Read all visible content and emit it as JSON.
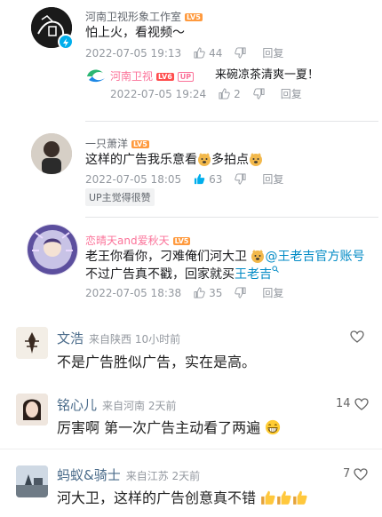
{
  "comments": [
    {
      "name": "河南卫视形象工作室",
      "level": "LV5",
      "text": "怕上火，看视频～",
      "time": "2022-07-05 19:13",
      "likes": "44",
      "reply_label": "回复",
      "subreply": {
        "name": "河南卫视",
        "level": "LV6",
        "badge": "UP",
        "text": "来碗凉茶清爽一夏！",
        "time": "2022-07-05 19:24",
        "likes": "2",
        "reply_label": "回复"
      }
    },
    {
      "name": "一只萧洋",
      "level": "LV5",
      "text_a": "这样的广告我乐意看",
      "text_b": "多拍点",
      "time": "2022-07-05 18:05",
      "likes": "63",
      "reply_label": "回复",
      "tag": "UP主觉得很赞"
    },
    {
      "name": "恋晴天and爱秋天",
      "level": "LV5",
      "line1_a": "老王你看你，刁难俺们河大卫",
      "line1_link": "@王老吉官方账号",
      "line2_a": "不过广告真不戳，回家就买",
      "line2_link": "王老吉",
      "time": "2022-07-05 18:38",
      "likes": "35",
      "reply_label": "回复"
    }
  ],
  "weibo_comments": [
    {
      "name": "文浩",
      "from": "来自陕西 10小时前",
      "text": "不是广告胜似广告，实在是高。",
      "likes": ""
    },
    {
      "name": "铭心儿",
      "from": "来自河南 2天前",
      "text": "厉害啊 第一次广告主动看了两遍",
      "likes": "14"
    },
    {
      "name": "蚂蚁&骑士",
      "from": "来自江苏 2天前",
      "text": "河大卫，这样的广告创意真不错",
      "likes": "7"
    }
  ],
  "colors": {
    "pink": "#fb7299",
    "link": "#008ac5",
    "liked": "#00aeec"
  }
}
